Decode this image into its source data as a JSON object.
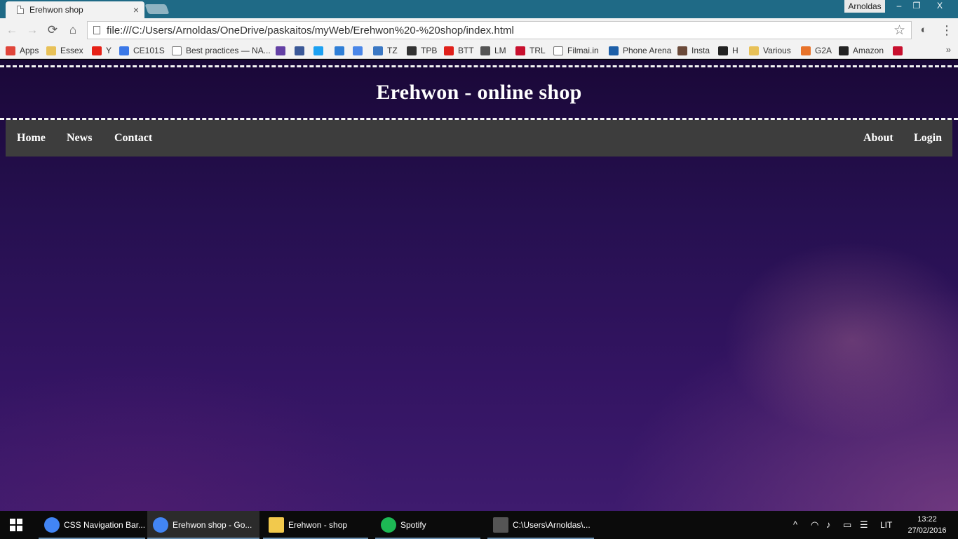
{
  "browser": {
    "tab": {
      "title": "Erehwon shop",
      "close": "×"
    },
    "profile": "Arnoldas",
    "window_controls": {
      "minimize": "–",
      "restore": "❐",
      "close": "X"
    },
    "toolbar": {
      "back": "←",
      "forward": "→",
      "reload": "⟳",
      "home": "⌂",
      "url": "file:///C:/Users/Arnoldas/OneDrive/paskaitos/myWeb/Erehwon%20-%20shop/index.html",
      "star": "☆",
      "menu": "⋮"
    },
    "bookmarks": [
      {
        "label": "Apps",
        "icon": "apps-grid-icon",
        "color": "#e0453a"
      },
      {
        "label": "Essex",
        "icon": "folder-icon",
        "color": "#e8c158"
      },
      {
        "label": "Y",
        "icon": "youtube-icon",
        "color": "#e62117"
      },
      {
        "label": "CE101S",
        "icon": "docs-icon",
        "color": "#3b78e7"
      },
      {
        "label": "Best practices — NA...",
        "icon": "page-icon",
        "color": "#ffffff"
      },
      {
        "label": "",
        "icon": "twitch-icon",
        "color": "#6441a5"
      },
      {
        "label": "",
        "icon": "facebook-icon",
        "color": "#3b5998"
      },
      {
        "label": "",
        "icon": "twitter-icon",
        "color": "#1da1f2"
      },
      {
        "label": "",
        "icon": "drop-icon",
        "color": "#2f7fd6"
      },
      {
        "label": "",
        "icon": "translate-icon",
        "color": "#4a87e8"
      },
      {
        "label": "TZ",
        "icon": "tz-icon",
        "color": "#3b78c4"
      },
      {
        "label": "TPB",
        "icon": "ship-icon",
        "color": "#333333"
      },
      {
        "label": "BTT",
        "icon": "btt-icon",
        "color": "#e0211b"
      },
      {
        "label": "LM",
        "icon": "lm-icon",
        "color": "#555555"
      },
      {
        "label": "TRL",
        "icon": "trl-icon",
        "color": "#c8102e"
      },
      {
        "label": "Filmai.in",
        "icon": "page-icon",
        "color": "#ffffff"
      },
      {
        "label": "Phone Arena",
        "icon": "phone-icon",
        "color": "#1d5fa8"
      },
      {
        "label": "Insta",
        "icon": "instagram-icon",
        "color": "#6b4a3a"
      },
      {
        "label": "H",
        "icon": "bz-icon",
        "color": "#222222"
      },
      {
        "label": "Various",
        "icon": "folder-icon",
        "color": "#e8c158"
      },
      {
        "label": "G2A",
        "icon": "g2a-icon",
        "color": "#e8732a"
      },
      {
        "label": "Amazon",
        "icon": "amazon-icon",
        "color": "#222222"
      },
      {
        "label": "",
        "icon": "uk-flag-icon",
        "color": "#c8102e"
      }
    ],
    "bookmarks_more": "»"
  },
  "site": {
    "title": "Erehwon - online shop",
    "nav_left": [
      "Home",
      "News",
      "Contact"
    ],
    "nav_right": [
      "About",
      "Login"
    ]
  },
  "taskbar": {
    "items": [
      {
        "label": "CSS Navigation Bar...",
        "icon": "chrome-icon",
        "active": false
      },
      {
        "label": "Erehwon shop - Go...",
        "icon": "chrome-icon",
        "active": true
      },
      {
        "label": "Erehwon - shop",
        "icon": "folder-icon",
        "active": false
      },
      {
        "label": "Spotify",
        "icon": "spotify-icon",
        "active": false
      },
      {
        "label": "C:\\Users\\Arnoldas\\...",
        "icon": "sublime-icon",
        "active": false
      }
    ],
    "tray": {
      "chevron": "^",
      "language": "LIT"
    },
    "clock": {
      "time": "13:22",
      "date": "27/02/2016"
    }
  }
}
